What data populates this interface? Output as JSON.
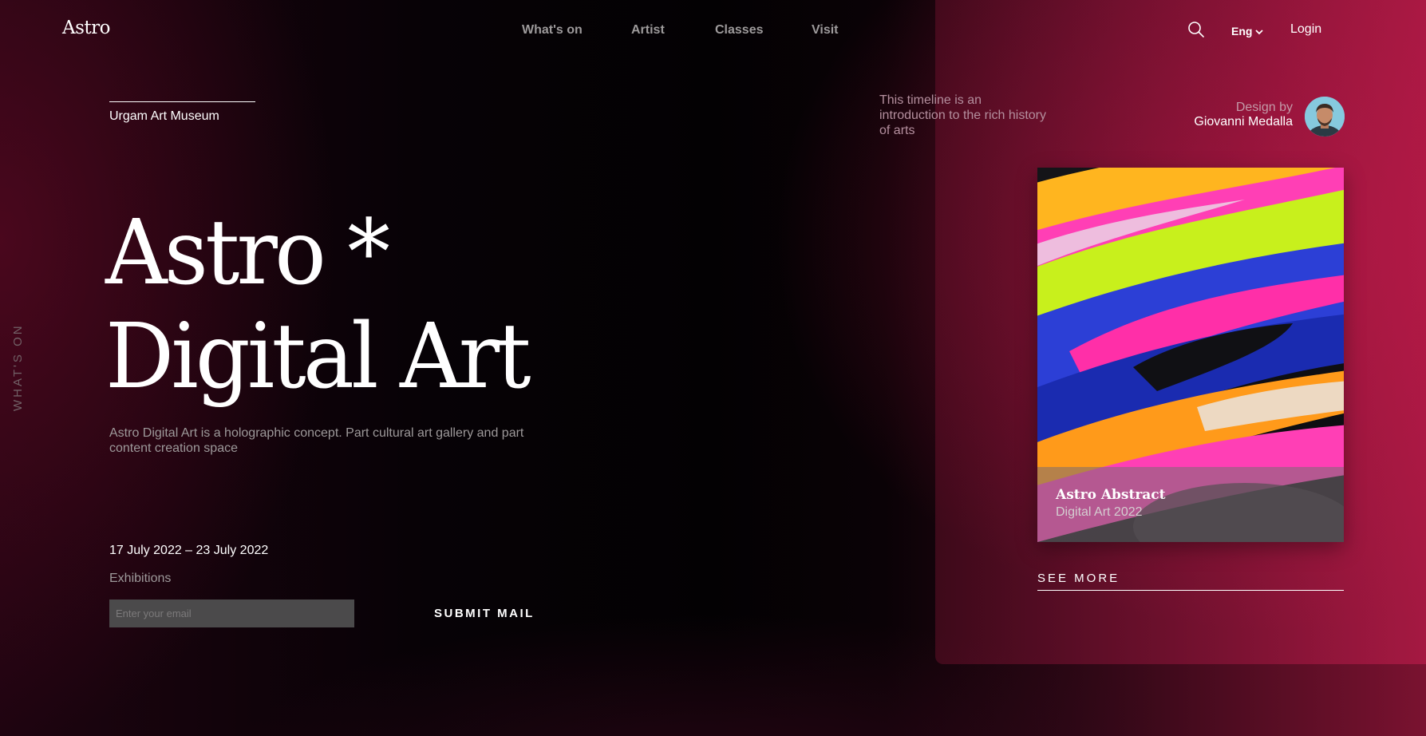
{
  "brand": {
    "logo": "Astro"
  },
  "nav": {
    "items": [
      "What's on",
      "Artist",
      "Classes",
      "Visit"
    ]
  },
  "header": {
    "language": "Eng",
    "login": "Login"
  },
  "hero": {
    "museum": "Urgam Art Museum",
    "title_line1": "Astro *",
    "title_line2": "Digital Art",
    "description": "Astro Digital Art is a holographic concept. Part cultural art gallery and part content creation space",
    "vertical_label": "WHAT'S ON"
  },
  "event": {
    "dates": "17 July 2022 – 23 July 2022",
    "category": "Exhibitions",
    "email_placeholder": "Enter your email",
    "submit_label": "SUBMIT MAIL"
  },
  "aside": {
    "timeline": "This timeline is an introduction to the rich history of arts",
    "design_by_label": "Design by",
    "designer": "Giovanni Medalla"
  },
  "card": {
    "title": "Astro Abstract",
    "subtitle": "Digital Art 2022",
    "see_more": "SEE MORE"
  },
  "colors": {
    "accent": "#c0174f",
    "background": "#050204"
  },
  "icons": [
    "search-icon",
    "chevron-down-icon"
  ]
}
